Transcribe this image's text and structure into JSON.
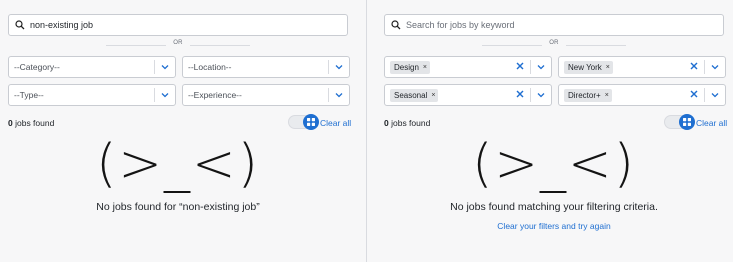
{
  "left": {
    "search": {
      "value": "non-existing job",
      "placeholder": ""
    },
    "or_label": "OR",
    "filters": {
      "category": "--Category--",
      "location": "--Location--",
      "type": "--Type--",
      "experience": "--Experience--"
    },
    "count_number": "0",
    "count_label": " jobs found",
    "clear_all": "Clear all",
    "emoticon": "(>_<)",
    "message": "No jobs found for “non-existing job”"
  },
  "right": {
    "search": {
      "value": "",
      "placeholder": "Search for jobs by keyword"
    },
    "or_label": "OR",
    "chips": {
      "category": "Design",
      "location": "New York",
      "type": "Seasonal",
      "experience": "Director+"
    },
    "chip_remove": "×",
    "count_number": "0",
    "count_label": " jobs found",
    "clear_all": "Clear all",
    "emoticon": "(>_<)",
    "message": "No jobs found matching your filtering criteria.",
    "link": "Clear your filters and try again"
  },
  "colors": {
    "accent": "#1f6fd1",
    "background": "#f7f7f8",
    "border": "#c9ccd2"
  },
  "icons": [
    "search-icon",
    "chevron-down-icon",
    "clear-x-icon",
    "grid-icon"
  ]
}
